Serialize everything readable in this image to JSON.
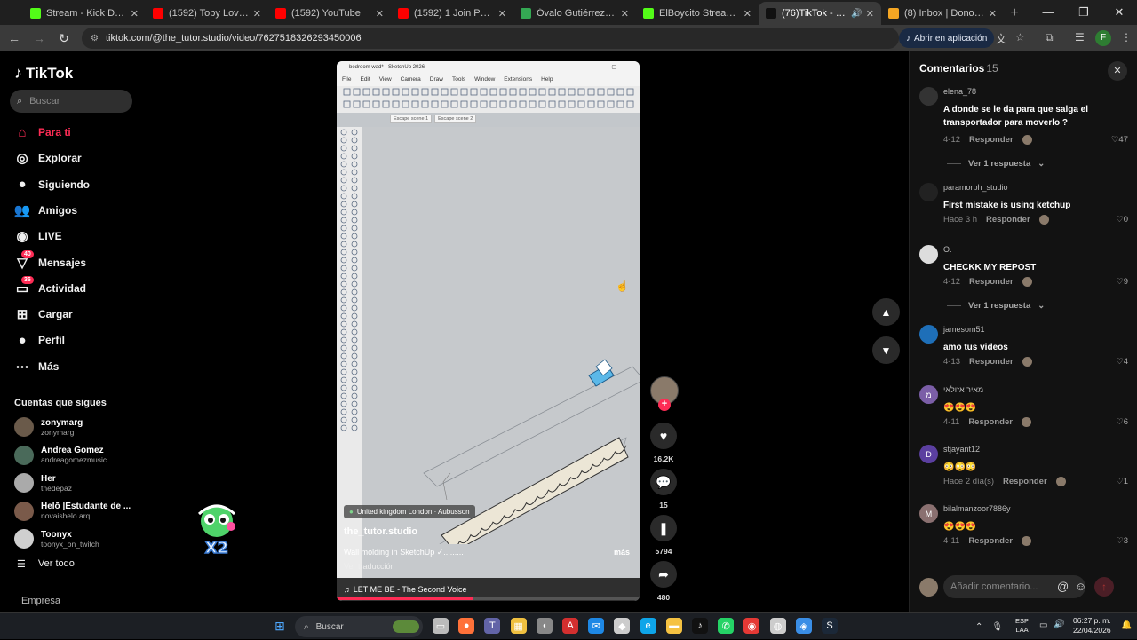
{
  "browser": {
    "tabs": [
      {
        "title": "Stream - Kick Dashboard",
        "color": "#53fc18",
        "active": false
      },
      {
        "title": "(1592) Toby Love - Tengo",
        "color": "#ff0000",
        "active": false
      },
      {
        "title": "(1592) YouTube",
        "color": "#ff0000",
        "active": false
      },
      {
        "title": "(1592) 1 Join Push Pull Pl",
        "color": "#ff0000",
        "active": false
      },
      {
        "title": "Óvalo Gutiérrez - Google",
        "color": "#34a853",
        "active": false
      },
      {
        "title": "ElBoycito Stream - Watch",
        "color": "#53fc18",
        "active": false
      },
      {
        "title": "(76)TikTok - Make Yo",
        "color": "#111111",
        "active": true
      },
      {
        "title": "(8) Inbox | Donoclip",
        "color": "#f5a623",
        "active": false
      }
    ],
    "url": "tiktok.com/@the_tutor.studio/video/7627518326293450006",
    "open_app_label": "Abrir en aplicación",
    "profile_initial": "F"
  },
  "sidebar": {
    "logo": "TikTok",
    "search_placeholder": "Buscar",
    "nav": [
      {
        "label": "Para ti",
        "icon": "home-icon",
        "active": true
      },
      {
        "label": "Explorar",
        "icon": "compass-icon",
        "active": false
      },
      {
        "label": "Siguiendo",
        "icon": "following-avatar-icon",
        "active": false
      },
      {
        "label": "Amigos",
        "icon": "friends-icon",
        "active": false
      },
      {
        "label": "LIVE",
        "icon": "live-icon",
        "active": false
      },
      {
        "label": "Mensajes",
        "icon": "messages-icon",
        "active": false,
        "badge": "40"
      },
      {
        "label": "Actividad",
        "icon": "activity-icon",
        "active": false,
        "badge": "36"
      },
      {
        "label": "Cargar",
        "icon": "upload-icon",
        "active": false
      },
      {
        "label": "Perfil",
        "icon": "profile-icon",
        "active": false
      },
      {
        "label": "Más",
        "icon": "more-icon",
        "active": false
      }
    ],
    "following_header": "Cuentas que sigues",
    "following": [
      {
        "name": "zonymarg",
        "handle": "zonymarg"
      },
      {
        "name": "Andrea Gomez",
        "handle": "andreagomezmusic"
      },
      {
        "name": "Her",
        "handle": "thedepaz"
      },
      {
        "name": "Helō |Estudante de ...",
        "handle": "novaishelo.arq"
      },
      {
        "name": "Toonyx",
        "handle": "toonyx_on_twitch"
      }
    ],
    "see_all": "Ver todo",
    "company": "Empresa"
  },
  "sticker": {
    "text": "X2"
  },
  "video": {
    "sketchup_title": "bedroom wad* - SketchUp 2026",
    "menu": [
      "File",
      "Edit",
      "View",
      "Camera",
      "Draw",
      "Tools",
      "Window",
      "Extensions",
      "Help"
    ],
    "scene_tabs": [
      "Escape scene 1",
      "Escape scene 2"
    ],
    "location": "United kingdom London · Aubusson",
    "author": "the_tutor.studio",
    "caption": "Wall molding in SketchUp ✓.........",
    "more": "más",
    "translate": "Ver traducción",
    "music": "LET ME BE - The Second Voice",
    "progress": 0.45
  },
  "actions": {
    "likes": "16.2K",
    "comments": "15",
    "saves": "5794",
    "shares": "480"
  },
  "comments": {
    "title": "Comentarios",
    "count": "15",
    "reply_label": "Responder",
    "items": [
      {
        "user": "elena_78",
        "text": "A donde se le da para que salga el transportador para moverlo ?",
        "date": "4-12",
        "likes": "47",
        "more_replies": "Ver 1 respuesta",
        "avatar_color": "#333333"
      },
      {
        "user": "paramorph_studio",
        "text": "First mistake is using ketchup",
        "date": "Hace 3 h",
        "likes": "0",
        "avatar_color": "#222222"
      },
      {
        "user": "O.",
        "text": "CHECKK MY REPOST",
        "date": "4-12",
        "likes": "9",
        "more_replies": "Ver 1 respuesta",
        "avatar_color": "#dddddd"
      },
      {
        "user": "jamesom51",
        "text": "amo tus videos",
        "date": "4-13",
        "likes": "4",
        "avatar_color": "#1e6fb8"
      },
      {
        "user": "מאיר אזולאי",
        "text": "😍😍😍",
        "date": "4-11",
        "likes": "6",
        "avatar_color": "#7b5ea7",
        "initial": "מ"
      },
      {
        "user": "stjayant12",
        "text": "😳😳😳",
        "date": "Hace 2 día(s)",
        "likes": "1",
        "avatar_color": "#5b3fa0",
        "initial": "D"
      },
      {
        "user": "bilalmanzoor7886y",
        "text": "😍😍😍",
        "date": "4-11",
        "likes": "3",
        "avatar_color": "#8a7070",
        "initial": "M"
      }
    ],
    "add_placeholder": "Añadir comentario..."
  },
  "taskbar": {
    "search": "Buscar",
    "lang": "ESP",
    "lang2": "LAA",
    "time": "06:27 p. m.",
    "date": "22/04/2026"
  }
}
